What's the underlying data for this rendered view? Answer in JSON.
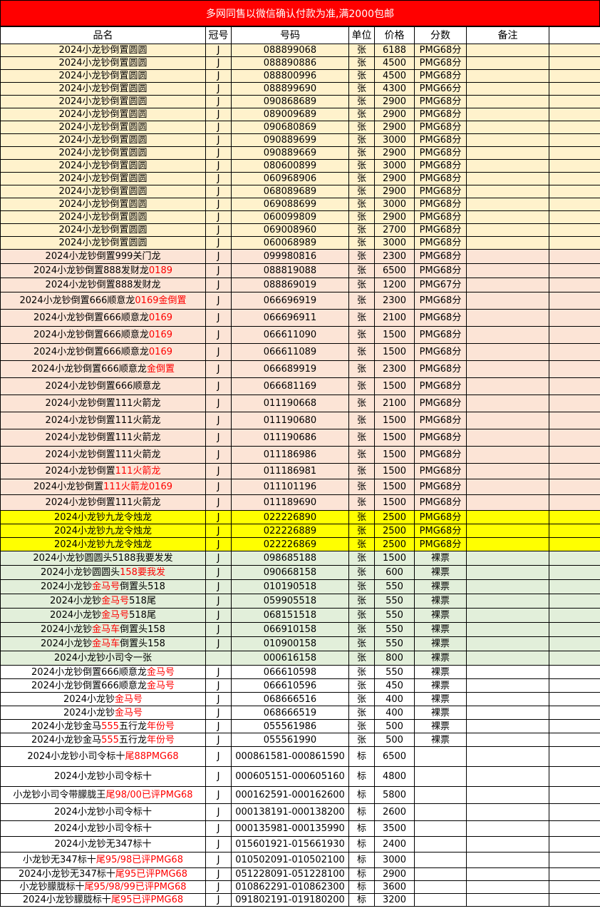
{
  "banner": "多网同售以微信确认付款为准,满2000包邮",
  "headers": [
    "品名",
    "冠号",
    "号码",
    "单位",
    "价格",
    "分数",
    "备注"
  ],
  "rows": [
    {
      "name": [
        [
          "2024小龙钞倒置圆圆",
          ""
        ]
      ],
      "crown": "J",
      "number": "088899068",
      "unit": "张",
      "price": "6188",
      "score": "PMG68分",
      "bg": "cream",
      "h": 18
    },
    {
      "name": [
        [
          "2024小龙钞倒置圆圆",
          ""
        ]
      ],
      "crown": "J",
      "number": "088890886",
      "unit": "张",
      "price": "4500",
      "score": "PMG68分",
      "bg": "cream",
      "h": 18
    },
    {
      "name": [
        [
          "2024小龙钞倒置圆圆",
          ""
        ]
      ],
      "crown": "J",
      "number": "088800996",
      "unit": "张",
      "price": "4500",
      "score": "PMG68分",
      "bg": "cream",
      "h": 18
    },
    {
      "name": [
        [
          "2024小龙钞倒置圆圆",
          ""
        ]
      ],
      "crown": "J",
      "number": "088899690",
      "unit": "张",
      "price": "4300",
      "score": "PMG66分",
      "bg": "cream",
      "h": 18
    },
    {
      "name": [
        [
          "2024小龙钞倒置圆圆",
          ""
        ]
      ],
      "crown": "J",
      "number": "090868689",
      "unit": "张",
      "price": "2900",
      "score": "PMG68分",
      "bg": "cream",
      "h": 18
    },
    {
      "name": [
        [
          "2024小龙钞倒置圆圆",
          ""
        ]
      ],
      "crown": "J",
      "number": "089009689",
      "unit": "张",
      "price": "2900",
      "score": "PMG68分",
      "bg": "cream",
      "h": 18
    },
    {
      "name": [
        [
          "2024小龙钞倒置圆圆",
          ""
        ]
      ],
      "crown": "J",
      "number": "090680869",
      "unit": "张",
      "price": "2900",
      "score": "PMG68分",
      "bg": "cream",
      "h": 18
    },
    {
      "name": [
        [
          "2024小龙钞倒置圆圆",
          ""
        ]
      ],
      "crown": "J",
      "number": "090889699",
      "unit": "张",
      "price": "3000",
      "score": "PMG68分",
      "bg": "cream",
      "h": 18
    },
    {
      "name": [
        [
          "2024小龙钞倒置圆圆",
          ""
        ]
      ],
      "crown": "J",
      "number": "090889669",
      "unit": "张",
      "price": "2900",
      "score": "PMG68分",
      "bg": "cream",
      "h": 18
    },
    {
      "name": [
        [
          "2024小龙钞倒置圆圆",
          ""
        ]
      ],
      "crown": "J",
      "number": "080600899",
      "unit": "张",
      "price": "3000",
      "score": "PMG68分",
      "bg": "cream",
      "h": 18
    },
    {
      "name": [
        [
          "2024小龙钞倒置圆圆",
          ""
        ]
      ],
      "crown": "J",
      "number": "060968906",
      "unit": "张",
      "price": "2900",
      "score": "PMG68分",
      "bg": "cream",
      "h": 18
    },
    {
      "name": [
        [
          "2024小龙钞倒置圆圆",
          ""
        ]
      ],
      "crown": "J",
      "number": "068089689",
      "unit": "张",
      "price": "2900",
      "score": "PMG68分",
      "bg": "cream",
      "h": 18
    },
    {
      "name": [
        [
          "2024小龙钞倒置圆圆",
          ""
        ]
      ],
      "crown": "J",
      "number": "069088699",
      "unit": "张",
      "price": "3000",
      "score": "PMG68分",
      "bg": "cream",
      "h": 18
    },
    {
      "name": [
        [
          "2024小龙钞倒置圆圆",
          ""
        ]
      ],
      "crown": "J",
      "number": "060099809",
      "unit": "张",
      "price": "2900",
      "score": "PMG68分",
      "bg": "cream",
      "h": 18
    },
    {
      "name": [
        [
          "2024小龙钞倒置圆圆",
          ""
        ]
      ],
      "crown": "J",
      "number": "069008960",
      "unit": "张",
      "price": "2700",
      "score": "PMG68分",
      "bg": "cream",
      "h": 18
    },
    {
      "name": [
        [
          "2024小龙钞倒置圆圆",
          ""
        ]
      ],
      "crown": "J",
      "number": "060068989",
      "unit": "张",
      "price": "3000",
      "score": "PMG68分",
      "bg": "cream",
      "h": 18
    },
    {
      "name": [
        [
          "2024小龙钞倒置999关门龙",
          ""
        ]
      ],
      "crown": "J",
      "number": "099980816",
      "unit": "张",
      "price": "2300",
      "score": "PMG68分",
      "bg": "pink",
      "h": 20
    },
    {
      "name": [
        [
          "2024小龙钞倒置888发财龙",
          ""
        ],
        [
          "0189",
          "red"
        ]
      ],
      "crown": "J",
      "number": "088819088",
      "unit": "张",
      "price": "6500",
      "score": "PMG68分",
      "bg": "pink",
      "h": 20
    },
    {
      "name": [
        [
          "2024小龙钞倒置888发财龙",
          ""
        ]
      ],
      "crown": "J",
      "number": "088869019",
      "unit": "张",
      "price": "1200",
      "score": "PMG67分",
      "bg": "pink",
      "h": 20
    },
    {
      "name": [
        [
          "2024小龙钞倒置666顺意龙",
          ""
        ],
        [
          "0169金倒置",
          "red"
        ]
      ],
      "crown": "J",
      "number": "066696919",
      "unit": "张",
      "price": "2300",
      "score": "PMG68分",
      "bg": "pink",
      "h": 24
    },
    {
      "name": [
        [
          "2024小龙钞倒置666顺意龙",
          ""
        ],
        [
          "0169",
          "red"
        ]
      ],
      "crown": "J",
      "number": "066696911",
      "unit": "张",
      "price": "2100",
      "score": "PMG68分",
      "bg": "pink",
      "h": 24
    },
    {
      "name": [
        [
          "2024小龙钞倒置666顺意龙",
          ""
        ],
        [
          "0169",
          "red"
        ]
      ],
      "crown": "J",
      "number": "066611090",
      "unit": "张",
      "price": "1500",
      "score": "PMG68分",
      "bg": "pink",
      "h": 24
    },
    {
      "name": [
        [
          "2024小龙钞倒置666顺意龙",
          ""
        ],
        [
          "0169",
          "red"
        ]
      ],
      "crown": "J",
      "number": "066611089",
      "unit": "张",
      "price": "1500",
      "score": "PMG68分",
      "bg": "pink",
      "h": 24
    },
    {
      "name": [
        [
          "2024小龙钞倒置666顺意龙",
          ""
        ],
        [
          "金倒置",
          "red"
        ]
      ],
      "crown": "J",
      "number": "066689919",
      "unit": "张",
      "price": "2300",
      "score": "PMG68分",
      "bg": "pink",
      "h": 24
    },
    {
      "name": [
        [
          "2024小龙钞倒置666顺意龙",
          ""
        ]
      ],
      "crown": "J",
      "number": "066681169",
      "unit": "张",
      "price": "1500",
      "score": "PMG68分",
      "bg": "pink",
      "h": 24
    },
    {
      "name": [
        [
          "2024小龙钞倒置111火箭龙",
          ""
        ]
      ],
      "crown": "J",
      "number": "011190668",
      "unit": "张",
      "price": "2100",
      "score": "PMG68分",
      "bg": "pink",
      "h": 24
    },
    {
      "name": [
        [
          "2024小龙钞倒置111火箭龙",
          ""
        ]
      ],
      "crown": "J",
      "number": "011190680",
      "unit": "张",
      "price": "1500",
      "score": "PMG68分",
      "bg": "pink",
      "h": 24
    },
    {
      "name": [
        [
          "2024小龙钞倒置111火箭龙",
          ""
        ]
      ],
      "crown": "J",
      "number": "011190686",
      "unit": "张",
      "price": "1500",
      "score": "PMG68分",
      "bg": "pink",
      "h": 24
    },
    {
      "name": [
        [
          "2024小龙钞倒置111火箭龙",
          ""
        ]
      ],
      "crown": "J",
      "number": "011186986",
      "unit": "张",
      "price": "1500",
      "score": "PMG68分",
      "bg": "pink",
      "h": 24
    },
    {
      "name": [
        [
          "2024小龙钞倒置",
          ""
        ],
        [
          "111火箭龙",
          "red"
        ]
      ],
      "crown": "J",
      "number": "011186981",
      "unit": "张",
      "price": "1500",
      "score": "PMG68分",
      "bg": "pink",
      "h": 22
    },
    {
      "name": [
        [
          "2024小龙钞倒置",
          ""
        ],
        [
          "111火箭龙0169",
          "red"
        ]
      ],
      "crown": "J",
      "number": "011101196",
      "unit": "张",
      "price": "1500",
      "score": "PMG68分",
      "bg": "pink",
      "h": 22
    },
    {
      "name": [
        [
          "2024小龙钞倒置111火箭龙",
          ""
        ]
      ],
      "crown": "J",
      "number": "011189690",
      "unit": "张",
      "price": "1500",
      "score": "PMG68分",
      "bg": "pink",
      "h": 22
    },
    {
      "name": [
        [
          "2024小龙钞九龙令烛龙",
          ""
        ]
      ],
      "crown": "J",
      "number": "022226890",
      "unit": "张",
      "price": "2500",
      "score": "PMG68分",
      "bg": "yellow",
      "h": 19
    },
    {
      "name": [
        [
          "2024小龙钞九龙令烛龙",
          ""
        ]
      ],
      "crown": "J",
      "number": "022226889",
      "unit": "张",
      "price": "2500",
      "score": "PMG68分",
      "bg": "yellow",
      "h": 19
    },
    {
      "name": [
        [
          "2024小龙钞九龙令烛龙",
          ""
        ]
      ],
      "crown": "J",
      "number": "022226869",
      "unit": "张",
      "price": "2500",
      "score": "PMG68分",
      "bg": "yellow",
      "h": 19
    },
    {
      "name": [
        [
          "2024小龙钞圆圆头5188我要发发",
          ""
        ]
      ],
      "crown": "J",
      "number": "098685188",
      "unit": "张",
      "price": "1500",
      "score": "裸票",
      "bg": "green",
      "h": 20
    },
    {
      "name": [
        [
          "2024小龙钞圆圆头",
          ""
        ],
        [
          "158要我发",
          "red"
        ]
      ],
      "crown": "J",
      "number": "090668158",
      "unit": "张",
      "price": "600",
      "score": "裸票",
      "bg": "green",
      "h": 20
    },
    {
      "name": [
        [
          "2024小龙钞",
          ""
        ],
        [
          "金马号",
          "red"
        ],
        [
          "倒置头518",
          ""
        ]
      ],
      "crown": "J",
      "number": "010190518",
      "unit": "张",
      "price": "550",
      "score": "裸票",
      "bg": "green",
      "h": 20
    },
    {
      "name": [
        [
          "2024小龙钞",
          ""
        ],
        [
          "金马号",
          "red"
        ],
        [
          "518尾",
          ""
        ]
      ],
      "crown": "J",
      "number": "059905518",
      "unit": "张",
      "price": "550",
      "score": "裸票",
      "bg": "green",
      "h": 20
    },
    {
      "name": [
        [
          "2024小龙钞",
          ""
        ],
        [
          "金马号",
          "red"
        ],
        [
          "518尾",
          ""
        ]
      ],
      "crown": "J",
      "number": "068151518",
      "unit": "张",
      "price": "550",
      "score": "裸票",
      "bg": "green",
      "h": 20
    },
    {
      "name": [
        [
          "2024小龙钞",
          ""
        ],
        [
          "金马车",
          "red"
        ],
        [
          "倒置头158",
          ""
        ]
      ],
      "crown": "J",
      "number": "066910158",
      "unit": "张",
      "price": "550",
      "score": "裸票",
      "bg": "green",
      "h": 20
    },
    {
      "name": [
        [
          "2024小龙钞",
          ""
        ],
        [
          "金马车",
          "red"
        ],
        [
          "倒置头158",
          ""
        ]
      ],
      "crown": "J",
      "number": "010900158",
      "unit": "张",
      "price": "550",
      "score": "裸票",
      "bg": "green",
      "h": 20
    },
    {
      "name": [
        [
          "2024小龙钞小司令一张",
          ""
        ]
      ],
      "crown": "",
      "number": "000616158",
      "unit": "张",
      "price": "800",
      "score": "裸票",
      "bg": "green",
      "h": 20
    },
    {
      "name": [
        [
          "2024小龙钞倒置666顺意龙",
          ""
        ],
        [
          "金马号",
          "red"
        ]
      ],
      "crown": "J",
      "number": "066610598",
      "unit": "张",
      "price": "550",
      "score": "裸票",
      "bg": "white",
      "h": 19
    },
    {
      "name": [
        [
          "2024小龙钞倒置666顺意龙",
          ""
        ],
        [
          "金马号",
          "red"
        ]
      ],
      "crown": "J",
      "number": "066610596",
      "unit": "张",
      "price": "450",
      "score": "裸票",
      "bg": "white",
      "h": 19
    },
    {
      "name": [
        [
          "2024小龙钞",
          ""
        ],
        [
          "金马号",
          "red"
        ]
      ],
      "crown": "J",
      "number": "068666516",
      "unit": "张",
      "price": "400",
      "score": "裸票",
      "bg": "white",
      "h": 19
    },
    {
      "name": [
        [
          "2024小龙钞",
          ""
        ],
        [
          "金马号",
          "red"
        ]
      ],
      "crown": "J",
      "number": "068666519",
      "unit": "张",
      "price": "400",
      "score": "裸票",
      "bg": "white",
      "h": 19
    },
    {
      "name": [
        [
          "2024小龙钞金马",
          ""
        ],
        [
          "555",
          "red"
        ],
        [
          "五行龙",
          ""
        ],
        [
          "年份号",
          "red"
        ]
      ],
      "crown": "J",
      "number": "055561986",
      "unit": "张",
      "price": "500",
      "score": "裸票",
      "bg": "white",
      "h": 19
    },
    {
      "name": [
        [
          "2024小龙钞金马",
          ""
        ],
        [
          "555",
          "red"
        ],
        [
          "五行龙",
          ""
        ],
        [
          "年份号",
          "red"
        ]
      ],
      "crown": "J",
      "number": "055561990",
      "unit": "张",
      "price": "500",
      "score": "裸票",
      "bg": "white",
      "h": 19
    },
    {
      "name": [
        [
          "2024小龙钞小司令标十",
          ""
        ],
        [
          "尾88PMG68",
          "red"
        ]
      ],
      "crown": "J",
      "number": "000861581-000861590",
      "unit": "标",
      "price": "6500",
      "score": "",
      "bg": "white",
      "h": 28
    },
    {
      "name": [
        [
          "2024小龙钞小司令标十",
          ""
        ]
      ],
      "crown": "J",
      "number": "000605151-000605160",
      "unit": "标",
      "price": "4800",
      "score": "",
      "bg": "white",
      "h": 28
    },
    {
      "name": [
        [
          "小龙钞小司令带朦胧王",
          ""
        ],
        [
          "尾98/00已评PMG68",
          "red"
        ]
      ],
      "crown": "J",
      "number": "000162591-000162600",
      "unit": "标",
      "price": "5800",
      "score": "",
      "bg": "white",
      "h": 24
    },
    {
      "name": [
        [
          "2024小龙钞小司令标十",
          ""
        ]
      ],
      "crown": "J",
      "number": "000138191-000138200",
      "unit": "标",
      "price": "2600",
      "score": "",
      "bg": "white",
      "h": 24
    },
    {
      "name": [
        [
          "2024小龙钞小司令标十",
          ""
        ]
      ],
      "crown": "J",
      "number": "000135981-000135990",
      "unit": "标",
      "price": "3500",
      "score": "",
      "bg": "white",
      "h": 22
    },
    {
      "name": [
        [
          "2024小龙钞无347标十",
          ""
        ]
      ],
      "crown": "J",
      "number": "015601921-015661930",
      "unit": "标",
      "price": "2400",
      "score": "",
      "bg": "white",
      "h": 22
    },
    {
      "name": [
        [
          "小龙钞无347标十",
          ""
        ],
        [
          "尾95/98已评PMG68",
          "red"
        ]
      ],
      "crown": "J",
      "number": "010502091-010502100",
      "unit": "标",
      "price": "3000",
      "score": "",
      "bg": "white",
      "h": 22
    },
    {
      "name": [
        [
          "2024小龙钞无347标十",
          ""
        ],
        [
          "尾95已评PMG68",
          "red"
        ]
      ],
      "crown": "J",
      "number": "051228091-051228100",
      "unit": "标",
      "price": "2900",
      "score": "",
      "bg": "white",
      "h": 18
    },
    {
      "name": [
        [
          "小龙钞朦胧标十",
          ""
        ],
        [
          "尾95/98/99已评PMG68",
          "red"
        ]
      ],
      "crown": "J",
      "number": "010862291-010862300",
      "unit": "标",
      "price": "3600",
      "score": "",
      "bg": "white",
      "h": 18
    },
    {
      "name": [
        [
          "2024小龙钞朦胧标十",
          ""
        ],
        [
          "尾95已评PMG68",
          "red"
        ]
      ],
      "crown": "J",
      "number": "091802191-019180200",
      "unit": "标",
      "price": "3200",
      "score": "",
      "bg": "white",
      "h": 18
    }
  ]
}
